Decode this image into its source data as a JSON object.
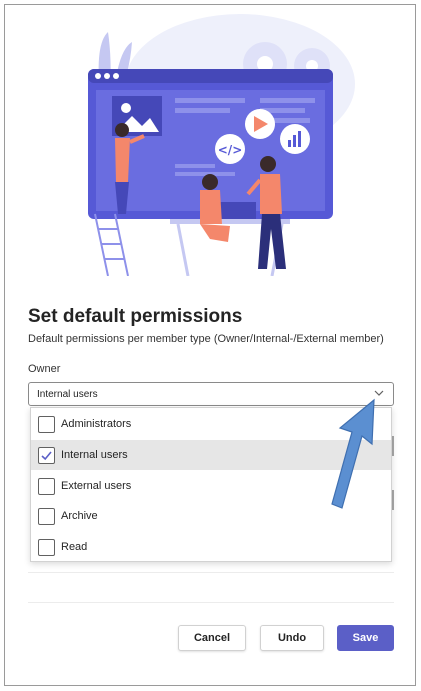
{
  "dialog": {
    "title": "Set default permissions",
    "subtitle": "Default permissions per member type (Owner/Internal-/External member)"
  },
  "owner_field": {
    "label": "Owner",
    "value": "Internal users",
    "chevron_icon": "chevron-down-icon"
  },
  "options": [
    {
      "label": "Administrators",
      "checked": false
    },
    {
      "label": "Internal users",
      "checked": true
    },
    {
      "label": "External users",
      "checked": false
    },
    {
      "label": "Archive",
      "checked": false
    },
    {
      "label": "Read",
      "checked": false
    }
  ],
  "buttons": {
    "cancel": "Cancel",
    "undo": "Undo",
    "save": "Save"
  },
  "colors": {
    "primary": "#5b5fc7",
    "annotation_arrow": "#5b8fd1",
    "illustration_accent": "#5659d6",
    "illustration_orange": "#f4876b"
  }
}
